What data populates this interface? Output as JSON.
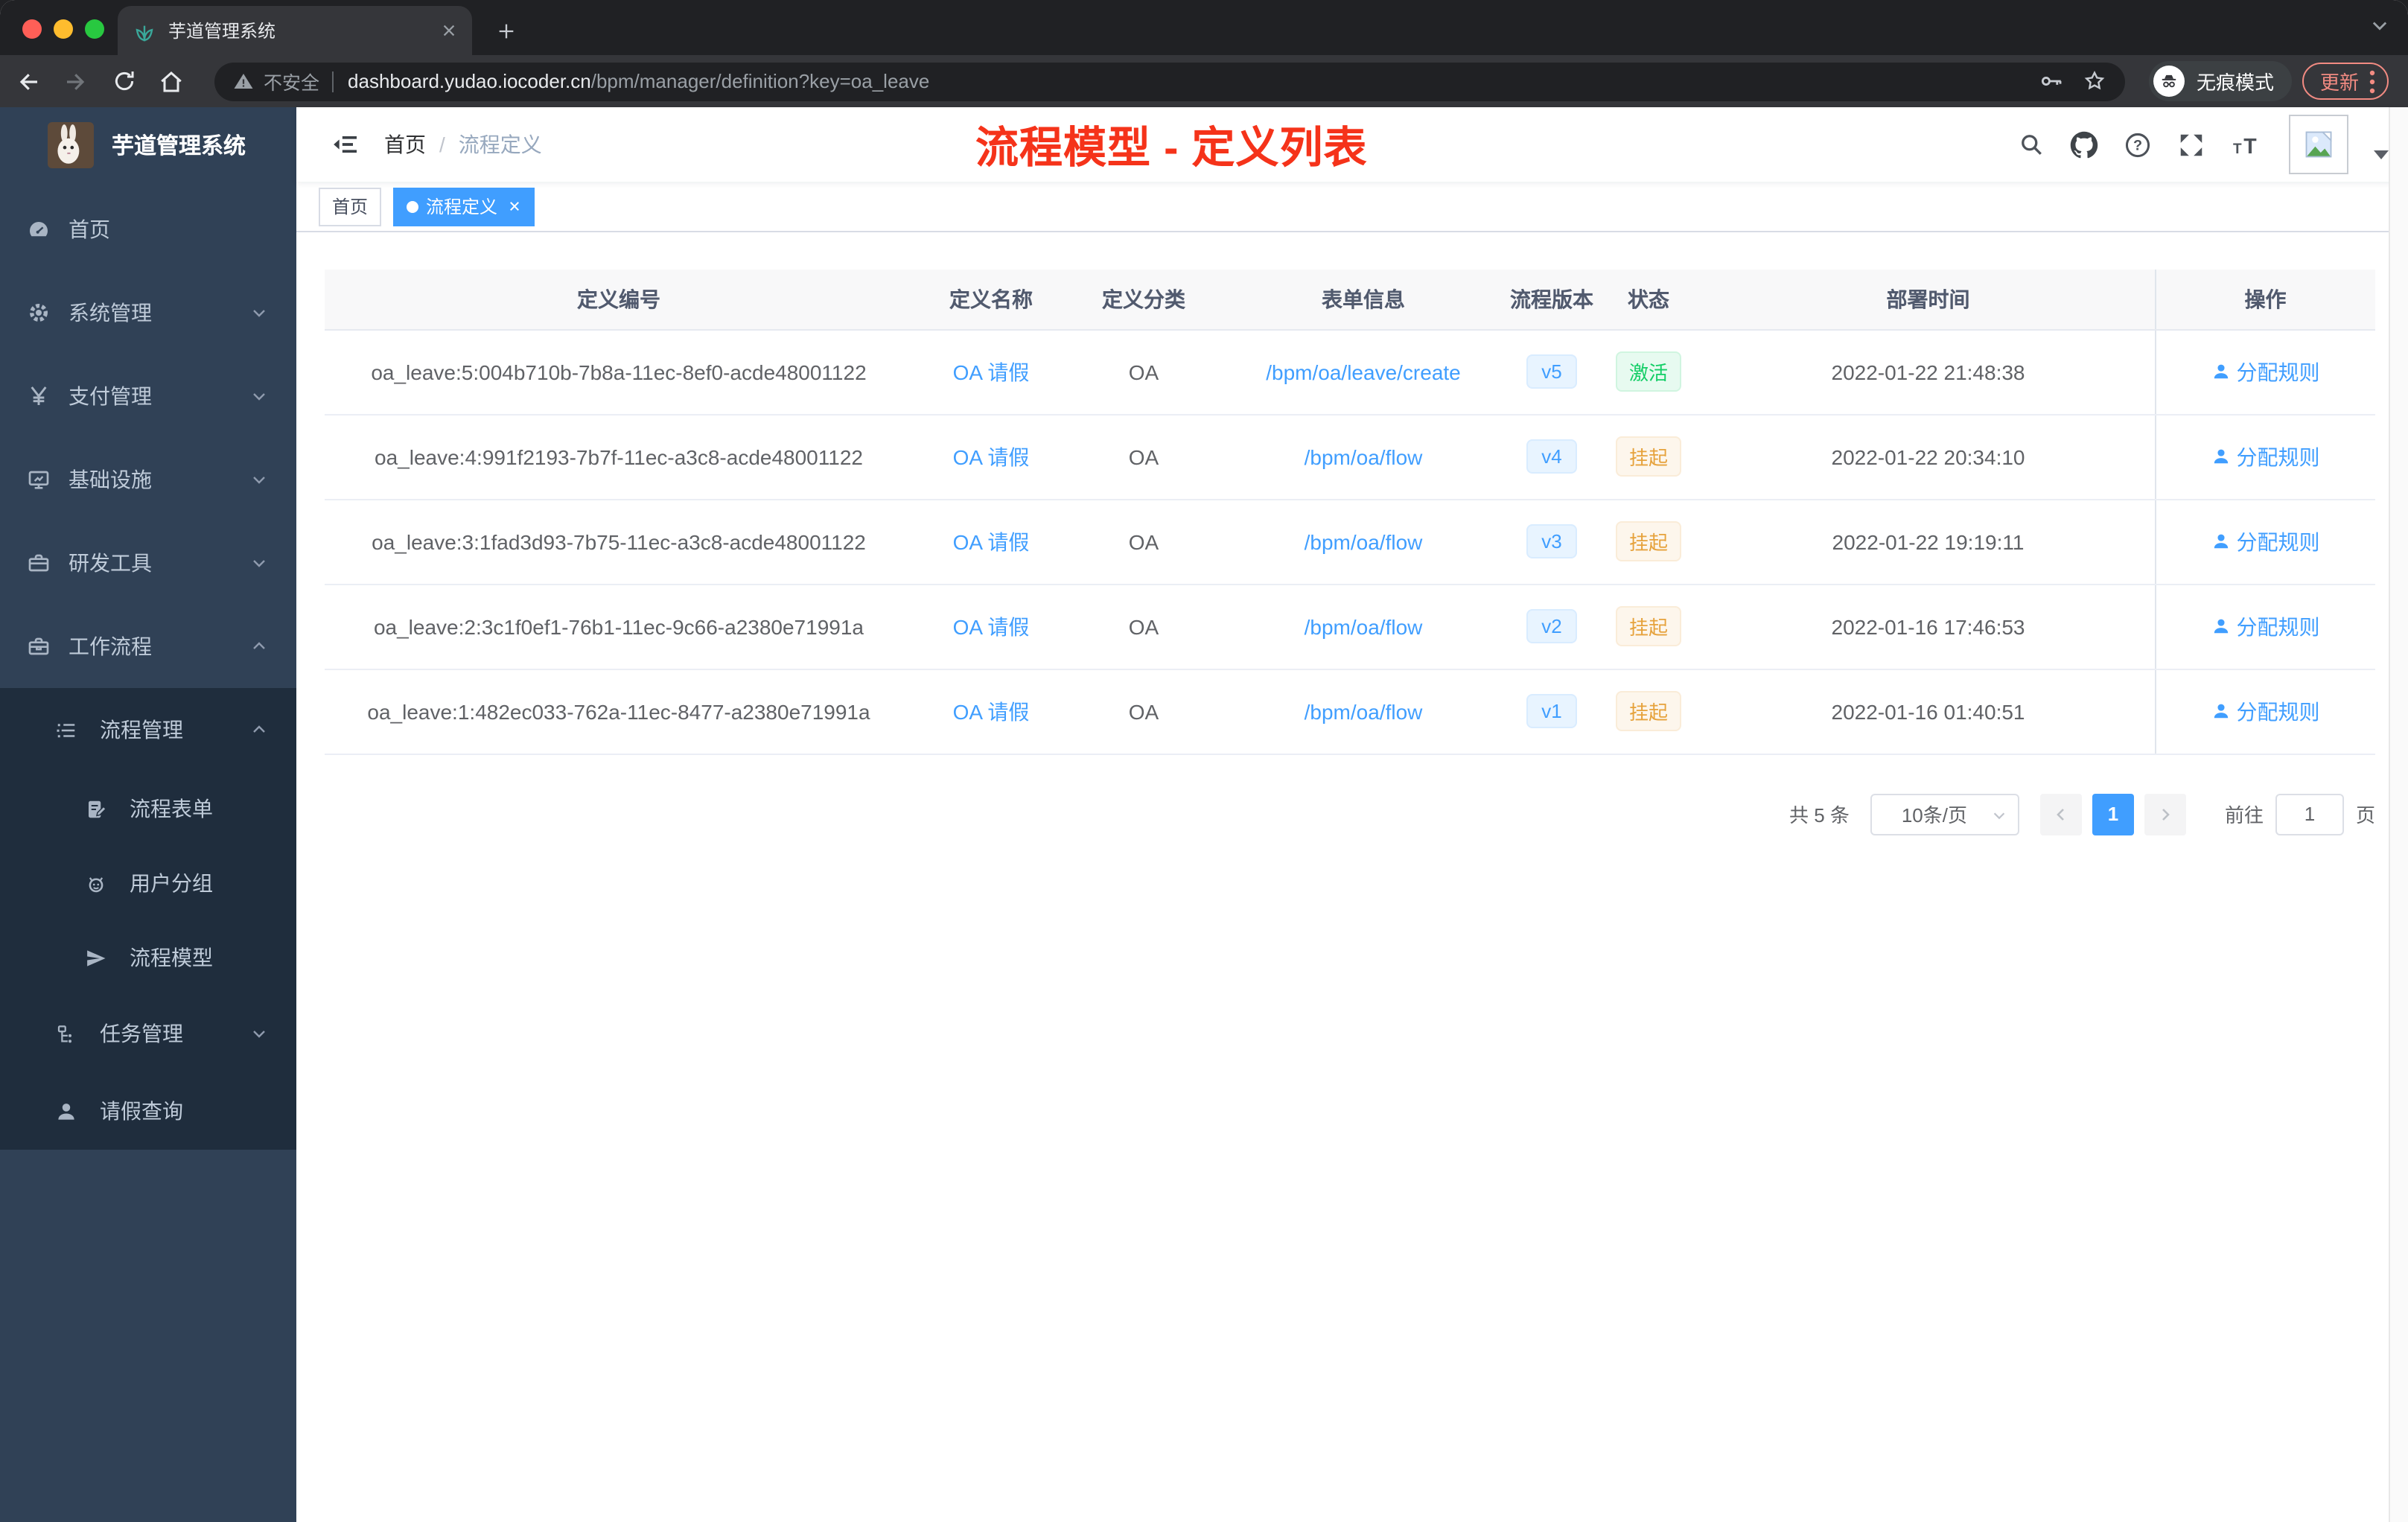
{
  "browser": {
    "tab_title": "芋道管理系统",
    "security_label": "不安全",
    "url_domain": "dashboard.yudao.iocoder.cn",
    "url_path": "/bpm/manager/definition?key=oa_leave",
    "incognito_label": "无痕模式",
    "update_label": "更新"
  },
  "sidebar": {
    "logo_title": "芋道管理系统",
    "items": [
      {
        "label": "首页"
      },
      {
        "label": "系统管理"
      },
      {
        "label": "支付管理"
      },
      {
        "label": "基础设施"
      },
      {
        "label": "研发工具"
      },
      {
        "label": "工作流程"
      },
      {
        "label": "流程管理"
      },
      {
        "label": "流程表单"
      },
      {
        "label": "用户分组"
      },
      {
        "label": "流程模型"
      },
      {
        "label": "任务管理"
      },
      {
        "label": "请假查询"
      }
    ]
  },
  "header": {
    "breadcrumb_home": "首页",
    "breadcrumb_separator": "/",
    "breadcrumb_current": "流程定义",
    "annotation": "流程模型 - 定义列表"
  },
  "tags": {
    "home": "首页",
    "active": "流程定义"
  },
  "table": {
    "columns": [
      "定义编号",
      "定义名称",
      "定义分类",
      "表单信息",
      "流程版本",
      "状态",
      "部署时间",
      "操作"
    ],
    "rows": [
      {
        "id": "oa_leave:5:004b710b-7b8a-11ec-8ef0-acde48001122",
        "name": "OA 请假",
        "category": "OA",
        "form": "/bpm/oa/leave/create",
        "version": "v5",
        "status": "激活",
        "deploy_time": "2022-01-22 21:48:38",
        "action": "分配规则"
      },
      {
        "id": "oa_leave:4:991f2193-7b7f-11ec-a3c8-acde48001122",
        "name": "OA 请假",
        "category": "OA",
        "form": "/bpm/oa/flow",
        "version": "v4",
        "status": "挂起",
        "deploy_time": "2022-01-22 20:34:10",
        "action": "分配规则"
      },
      {
        "id": "oa_leave:3:1fad3d93-7b75-11ec-a3c8-acde48001122",
        "name": "OA 请假",
        "category": "OA",
        "form": "/bpm/oa/flow",
        "version": "v3",
        "status": "挂起",
        "deploy_time": "2022-01-22 19:19:11",
        "action": "分配规则"
      },
      {
        "id": "oa_leave:2:3c1f0ef1-76b1-11ec-9c66-a2380e71991a",
        "name": "OA 请假",
        "category": "OA",
        "form": "/bpm/oa/flow",
        "version": "v2",
        "status": "挂起",
        "deploy_time": "2022-01-16 17:46:53",
        "action": "分配规则"
      },
      {
        "id": "oa_leave:1:482ec033-762a-11ec-8477-a2380e71991a",
        "name": "OA 请假",
        "category": "OA",
        "form": "/bpm/oa/flow",
        "version": "v1",
        "status": "挂起",
        "deploy_time": "2022-01-16 01:40:51",
        "action": "分配规则"
      }
    ]
  },
  "pagination": {
    "total_label": "共 5 条",
    "page_size_label": "10条/页",
    "current_page": "1",
    "goto_label": "前往",
    "goto_value": "1",
    "page_suffix": "页"
  },
  "colors": {
    "accent": "#409eff",
    "success": "#13ce66",
    "warning": "#e6a23c",
    "annotation_red": "#f5331a",
    "sidebar_bg": "#304156",
    "submenu_bg": "#1f2d3d"
  }
}
